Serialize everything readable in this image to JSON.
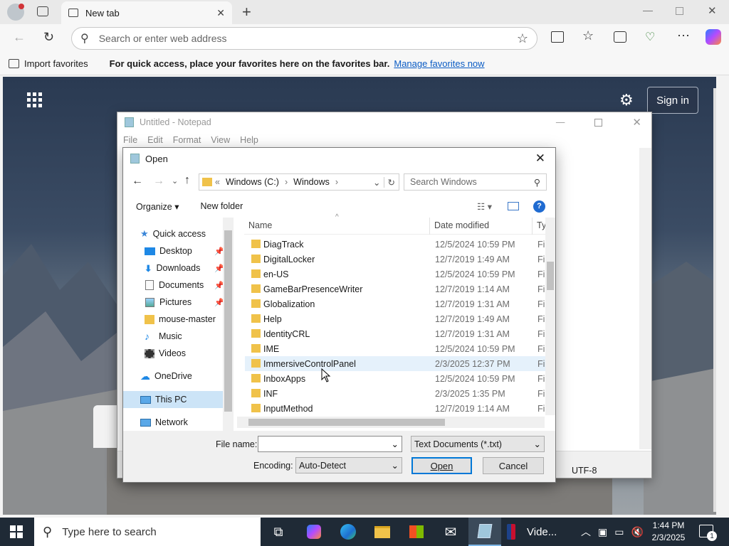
{
  "browser": {
    "tab_title": "New tab",
    "address_placeholder": "Search or enter web address",
    "import_favorites": "Import favorites",
    "favbar_message": "For quick access, place your favorites here on the favorites bar.",
    "manage_favorites": "Manage favorites now",
    "sign_in": "Sign in",
    "colors": {
      "link": "#0a5bc4",
      "signin_border": "#aab4c2"
    }
  },
  "notepad": {
    "title": "Untitled - Notepad",
    "menu": [
      "File",
      "Edit",
      "Format",
      "View",
      "Help"
    ],
    "encoding_status": "UTF-8"
  },
  "dialog": {
    "title": "Open",
    "breadcrumb": [
      "Windows (C:)",
      "Windows"
    ],
    "search_placeholder": "Search Windows",
    "organize": "Organize",
    "new_folder": "New folder",
    "nav": [
      {
        "label": "Quick access",
        "icon": "star-icon",
        "level": 0
      },
      {
        "label": "Desktop",
        "icon": "desktop-icon",
        "level": 1,
        "pinned": true
      },
      {
        "label": "Downloads",
        "icon": "download-icon",
        "level": 1,
        "pinned": true
      },
      {
        "label": "Documents",
        "icon": "document-icon",
        "level": 1,
        "pinned": true
      },
      {
        "label": "Pictures",
        "icon": "picture-icon",
        "level": 1,
        "pinned": true
      },
      {
        "label": "mouse-master",
        "icon": "folder-icon",
        "level": 1
      },
      {
        "label": "Music",
        "icon": "music-icon",
        "level": 1
      },
      {
        "label": "Videos",
        "icon": "video-icon",
        "level": 1
      },
      {
        "label": "OneDrive",
        "icon": "cloud-icon",
        "level": 0
      },
      {
        "label": "This PC",
        "icon": "computer-icon",
        "level": 0,
        "selected": true
      },
      {
        "label": "Network",
        "icon": "network-icon",
        "level": 0
      }
    ],
    "columns": {
      "name": "Name",
      "date": "Date modified",
      "type": "Ty"
    },
    "rows": [
      {
        "name": "DiagTrack",
        "date": "12/5/2024 10:59 PM",
        "type": "Fi"
      },
      {
        "name": "DigitalLocker",
        "date": "12/7/2019 1:49 AM",
        "type": "Fi"
      },
      {
        "name": "en-US",
        "date": "12/5/2024 10:59 PM",
        "type": "Fi"
      },
      {
        "name": "GameBarPresenceWriter",
        "date": "12/7/2019 1:14 AM",
        "type": "Fi"
      },
      {
        "name": "Globalization",
        "date": "12/7/2019 1:31 AM",
        "type": "Fi"
      },
      {
        "name": "Help",
        "date": "12/7/2019 1:49 AM",
        "type": "Fi"
      },
      {
        "name": "IdentityCRL",
        "date": "12/7/2019 1:31 AM",
        "type": "Fi"
      },
      {
        "name": "IME",
        "date": "12/5/2024 10:59 PM",
        "type": "Fi"
      },
      {
        "name": "ImmersiveControlPanel",
        "date": "2/3/2025 12:37 PM",
        "type": "Fi",
        "hover": true
      },
      {
        "name": "InboxApps",
        "date": "12/5/2024 10:59 PM",
        "type": "Fi"
      },
      {
        "name": "INF",
        "date": "2/3/2025 1:35 PM",
        "type": "Fi"
      },
      {
        "name": "InputMethod",
        "date": "12/7/2019 1:14 AM",
        "type": "Fi"
      }
    ],
    "file_name_label": "File name:",
    "file_name_value": "",
    "file_type": "Text Documents (*.txt)",
    "encoding_label": "Encoding:",
    "encoding_value": "Auto-Detect",
    "open_button": "Open",
    "cancel_button": "Cancel"
  },
  "taskbar": {
    "search_placeholder": "Type here to search",
    "app_label": "Vide...",
    "time": "1:44 PM",
    "date": "2/3/2025",
    "notification_count": "1"
  }
}
